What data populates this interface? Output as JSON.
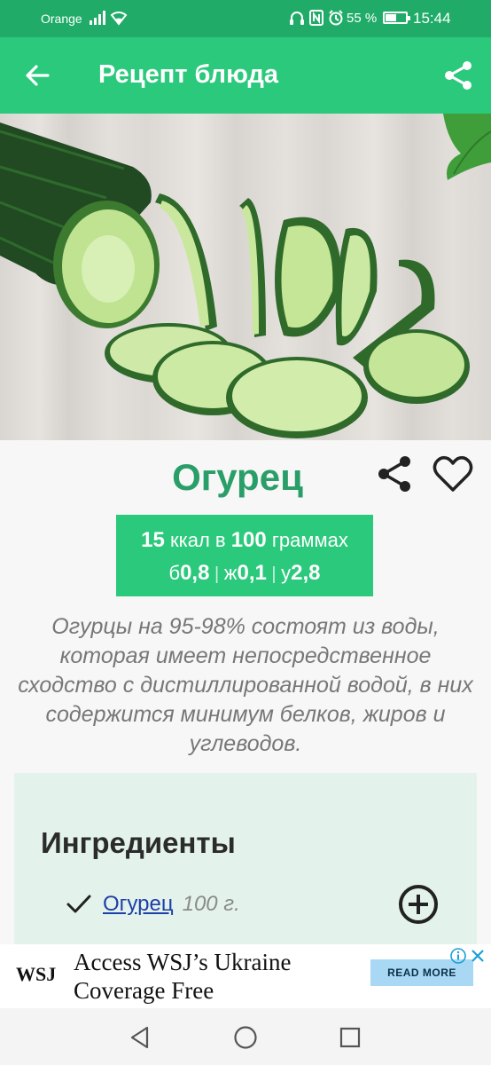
{
  "status_bar": {
    "carrier": "Orange",
    "battery_percent_text": "55 %",
    "battery_level": 0.55,
    "time": "15:44",
    "icons": [
      "signal-icon",
      "wifi-icon",
      "headphones-icon",
      "nfc-icon",
      "alarm-icon",
      "battery-icon"
    ]
  },
  "app_bar": {
    "title": "Рецепт блюда",
    "back_icon": "arrow-left-icon",
    "share_icon": "share-icon"
  },
  "hero": {
    "subject": "cucumber"
  },
  "food": {
    "name": "Огурец",
    "share_icon": "share-icon",
    "favorite_icon": "heart-outline-icon"
  },
  "nutrition": {
    "kcal": "15",
    "kcal_label": " ккал в ",
    "amount": "100",
    "amount_label": " граммах",
    "protein_label": "б",
    "protein": "0,8",
    "fat_label": "ж",
    "fat": "0,1",
    "carbs_label": "у",
    "carbs": "2,8",
    "separator": " | "
  },
  "description": "Огурцы на 95-98% состоят из воды, которая имеет непосредственное сходство с дистиллированной водой, в них содержится минимум белков, жиров и углеводов.",
  "ingredients": {
    "heading": "Ингредиенты",
    "items": [
      {
        "name": "Огурец",
        "quantity": "100 г."
      }
    ],
    "add_icon": "plus-circle-icon",
    "check_icon": "check-icon"
  },
  "ad": {
    "logo": "WSJ",
    "headline": "Access WSJ’s Ukraine Coverage Free",
    "cta": "READ MORE",
    "info_icon": "info-icon",
    "close_icon": "close-icon"
  },
  "nav": {
    "back_icon": "triangle-back-icon",
    "home_icon": "circle-home-icon",
    "recents_icon": "square-recents-icon"
  },
  "colors": {
    "status_bar": "#20ac68",
    "app_bar": "#2bc97c",
    "accent_text": "#2a9e68",
    "card_bg": "#e3f3ec",
    "link": "#1e3fa8"
  }
}
